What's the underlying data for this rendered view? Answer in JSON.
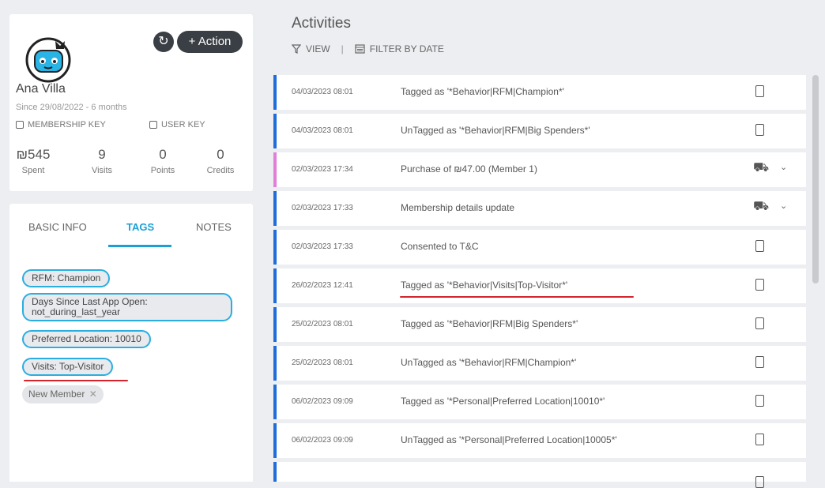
{
  "profile": {
    "name": "Ana Villa",
    "since": "Since 29/08/2022 - 6 months",
    "action_label": "+ Action",
    "membership_key_label": "MEMBERSHIP KEY",
    "user_key_label": "USER KEY",
    "stats": [
      {
        "value": "₪545",
        "label": "Spent"
      },
      {
        "value": "9",
        "label": "Visits"
      },
      {
        "value": "0",
        "label": "Points"
      },
      {
        "value": "0",
        "label": "Credits"
      }
    ]
  },
  "tabs": [
    {
      "label": "BASIC INFO"
    },
    {
      "label": "TAGS",
      "active": true
    },
    {
      "label": "NOTES"
    }
  ],
  "tags": [
    {
      "label": "RFM: Champion"
    },
    {
      "label": "Days Since Last App Open: not_during_last_year"
    },
    {
      "label": "Preferred Location: 10010"
    },
    {
      "label": "Visits: Top-Visitor"
    },
    {
      "label": "New Member"
    }
  ],
  "activities": {
    "title": "Activities",
    "view_label": "VIEW",
    "filter_label": "FILTER BY DATE",
    "rows": [
      {
        "date": "04/03/2023 08:01",
        "text": "Tagged as '*Behavior|RFM|Champion*'",
        "icon": "device-icon"
      },
      {
        "date": "04/03/2023 08:01",
        "text": "UnTagged as '*Behavior|RFM|Big Spenders*'",
        "icon": "device-icon"
      },
      {
        "date": "02/03/2023 17:34",
        "text": "Purchase of ₪47.00 (Member 1)",
        "icon": "cart-icon"
      },
      {
        "date": "02/03/2023 17:33",
        "text": "Membership details update",
        "icon": "cart-icon"
      },
      {
        "date": "02/03/2023 17:33",
        "text": "Consented to T&C",
        "icon": "device-icon"
      },
      {
        "date": "26/02/2023 12:41",
        "text": "Tagged as '*Behavior|Visits|Top-Visitor*'",
        "icon": "device-icon"
      },
      {
        "date": "25/02/2023 08:01",
        "text": "Tagged as '*Behavior|RFM|Big Spenders*'",
        "icon": "device-icon"
      },
      {
        "date": "25/02/2023 08:01",
        "text": "UnTagged as '*Behavior|RFM|Champion*'",
        "icon": "device-icon"
      },
      {
        "date": "06/02/2023 09:09",
        "text": "Tagged as '*Personal|Preferred Location|10010*'",
        "icon": "device-icon"
      },
      {
        "date": "06/02/2023 09:09",
        "text": "UnTagged as '*Personal|Preferred Location|10005*'",
        "icon": "device-icon"
      }
    ]
  },
  "colors": {
    "accent": "#1aa0d6",
    "row_bar": "#1f6dd8",
    "purchase_bar": "#e07ed8",
    "annotation": "#d4242c"
  }
}
